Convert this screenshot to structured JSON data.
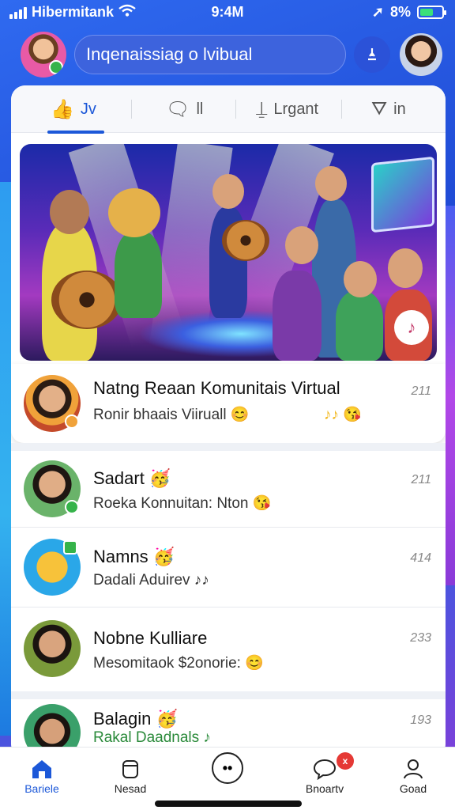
{
  "status_bar": {
    "carrier": "Hibermitank",
    "time": "9:4M",
    "battery": "8%",
    "battery_level": 0.6
  },
  "header": {
    "search_placeholder": "Inqenaissiag o lvibual",
    "action_icon": "location-pin-icon"
  },
  "tabs": [
    {
      "label": "Jv",
      "icon": "thumbs-up-icon",
      "active": true
    },
    {
      "label": "ll",
      "icon": "chat-bubble-icon",
      "active": false
    },
    {
      "label": "Lrgant",
      "icon": "tag-icon",
      "active": false
    },
    {
      "label": "in",
      "icon": "share-icon",
      "active": false
    }
  ],
  "featured": {
    "name": "Natng Reaan Komunitais Virtual",
    "message": "Ronir bhaais Viiruall 😊",
    "emoji": "♪♪ 😘",
    "time": "211"
  },
  "chats": [
    {
      "name": "Sadart 🥳",
      "message": "Roeka Konnuitan: Nton 😘",
      "time": "211"
    },
    {
      "name": "Namns 🥳",
      "message": "Dadali Aduirev ♪♪",
      "time": "414"
    },
    {
      "name": "Nobne Kulliare",
      "message": "Mesomitaok $2onorie: 😊",
      "time": "233"
    },
    {
      "name": "Balagin 🥳",
      "message": "Rakal Daadnals ♪",
      "time": "193"
    }
  ],
  "nav": [
    {
      "label": "Bariele",
      "icon": "home-icon",
      "active": true
    },
    {
      "label": "Nesad",
      "icon": "cup-icon",
      "active": false
    },
    {
      "label": "",
      "icon": "chat-bot-icon",
      "active": false
    },
    {
      "label": "Bnoartv",
      "icon": "message-icon",
      "active": false,
      "badge": "x"
    },
    {
      "label": "Goad",
      "icon": "profile-icon",
      "active": false
    }
  ],
  "colors": {
    "accent": "#1c58d8",
    "header_bg": "#1e4fd6",
    "badge": "#e53935"
  }
}
